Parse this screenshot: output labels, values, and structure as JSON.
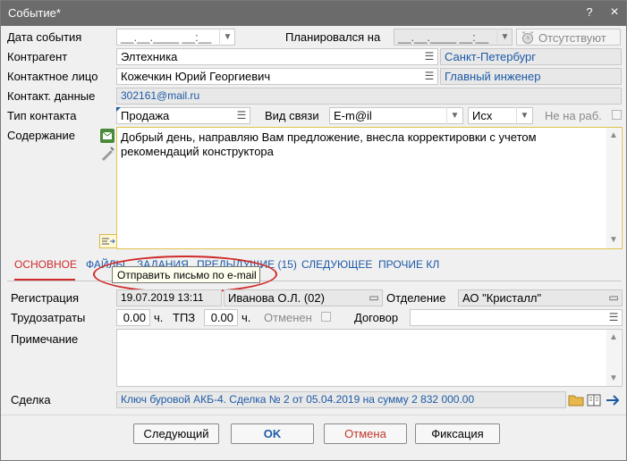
{
  "window": {
    "title": "Событие*",
    "help_btn": "?",
    "close_btn": "×"
  },
  "colors": {
    "titlebar": "#6b6b6b",
    "link": "#1d5aa6",
    "active_tab": "#d02a2a",
    "ok_label": "#1d5aa6",
    "cancel_label": "#c0392b",
    "tooltip_circle": "#d02a2a"
  },
  "form": {
    "event_date_label": "Дата события",
    "event_date_value": "__.__.____ __:__",
    "planned_label": "Планировался на",
    "planned_value": "__.__.____ __:__",
    "absent_label": "Отсутствуют",
    "counterparty_label": "Контрагент",
    "counterparty_value": "Элтехника",
    "counterparty_city": "Санкт-Петербург",
    "contact_person_label": "Контактное лицо",
    "contact_person_value": "Кожечкин Юрий Георгиевич",
    "contact_position": "Главный инженер",
    "contact_data_label": "Контакт. данные",
    "contact_data_value": "302161@mail.ru",
    "contact_type_label": "Тип контакта",
    "contact_type_value": "Продажа",
    "comm_type_label": "Вид связи",
    "comm_type_value": "E-m@il",
    "direction_value": "Исх",
    "not_working_label": "Не на раб.",
    "content_label": "Содержание",
    "content_text": "Добрый день, направляю Вам предложение, внесла корректировки с учетом рекомендаций конструктора"
  },
  "tabs": [
    {
      "label": "ОСНОВНОЕ"
    },
    {
      "label": "ФАЙЛЫ"
    },
    {
      "label": "ЗАДАНИЯ"
    },
    {
      "label": "ПРЕДЫДУЩИЕ (15)"
    },
    {
      "label": "СЛЕДУЮЩЕЕ"
    },
    {
      "label": "ПРОЧИЕ КЛ"
    }
  ],
  "tooltip": {
    "text": "Отправить письмо по e-mail"
  },
  "main": {
    "registration_label": "Регистрация",
    "registration_date": "19.07.2019 13:11",
    "registration_user": "Иванова О.Л. (02)",
    "department_label": "Отделение",
    "department_value": "АО \"Кристалл\"",
    "labor_label": "Трудозатраты",
    "labor_value": "0.00",
    "labor_unit": "ч.",
    "tpz_label": "ТПЗ",
    "tpz_value": "0.00",
    "tpz_unit": "ч.",
    "cancelled_label": "Отменен",
    "contract_label": "Договор",
    "contract_value": "",
    "note_label": "Примечание",
    "note_value": "",
    "deal_label": "Сделка",
    "deal_value": "Ключ буровой АКБ-4. Сделка № 2 от 05.04.2019 на сумму 2 832 000.00"
  },
  "buttons": {
    "next": "Следующий",
    "ok": "OK",
    "cancel": "Отмена",
    "fix": "Фиксация"
  },
  "icons": {
    "calendar": "calendar-icon",
    "alarm": "alarm-clock-icon",
    "list": "list-icon",
    "folder": "folder-icon",
    "book": "book-icon",
    "arrow": "arrow-right-icon",
    "email_send": "email-send-icon",
    "edit": "edit-icon",
    "insert": "insert-text-icon"
  }
}
